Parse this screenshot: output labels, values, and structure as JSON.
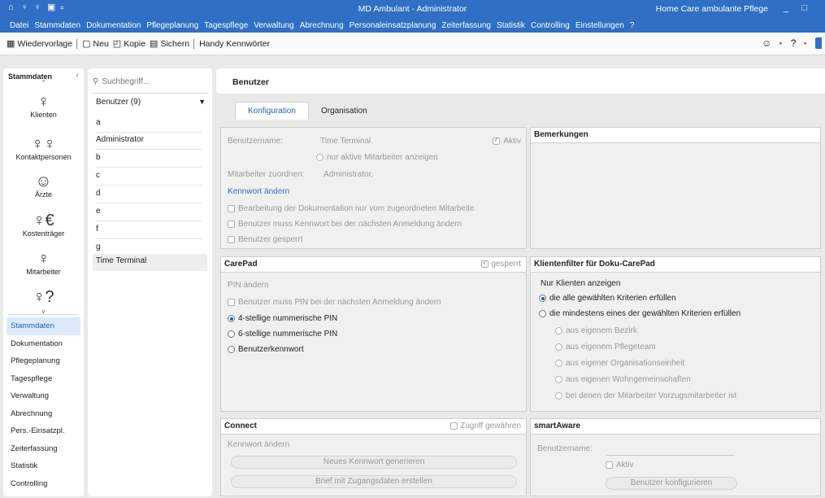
{
  "titlebar": {
    "title": "MD Ambulant - Administrator",
    "right_title": "Home Care ambulante Pflege",
    "minimize": "_",
    "maximize": "□"
  },
  "menu": [
    "Datei",
    "Stammdaten",
    "Dokumentation",
    "Pflegeplanung",
    "Tagespflege",
    "Verwaltung",
    "Abrechnung",
    "Personaleinsatzplanung",
    "Zeiterfassung",
    "Statistik",
    "Controlling",
    "Einstellungen",
    "?"
  ],
  "toolbar": {
    "wiedervorlage": "Wiedervorlage",
    "neu": "Neu",
    "kopie": "Kopie",
    "sichern": "Sichern",
    "handy": "Handy Kennwörter"
  },
  "leftnav": {
    "heading": "Stammdaten",
    "icons": [
      {
        "label": "Klienten",
        "icon": "person-icon"
      },
      {
        "label": "Kontaktpersonen",
        "icon": "persons-icon"
      },
      {
        "label": "Ärzte",
        "icon": "doctor-icon"
      },
      {
        "label": "Kostenträger",
        "icon": "payer-icon"
      },
      {
        "label": "Mitarbeiter",
        "icon": "employee-icon"
      }
    ],
    "modules": [
      "Stammdaten",
      "Dokumentation",
      "Pflegeplanung",
      "Tagespflege",
      "Verwaltung",
      "Abrechnung",
      "Pers.-Einsatzpl.",
      "Zeiterfassung",
      "Statistik",
      "Controlling"
    ]
  },
  "userlist": {
    "search_placeholder": "Suchbegriff...",
    "group": "Benutzer (9)",
    "items": [
      "a",
      "Administrator",
      "b",
      "c",
      "d",
      "e",
      "f",
      "g",
      "Time Terminal"
    ]
  },
  "main": {
    "header": "Benutzer",
    "tabs": [
      "Konfiguration",
      "Organisation"
    ],
    "config": {
      "username_label": "Benutzername:",
      "username_value": "Time Terminal",
      "aktiv": "Aktiv",
      "only_active": "nur aktive Mitarbeiter anzeigen",
      "assign_label": "Mitarbeiter zuordnen:",
      "assign_value": "Administrator,",
      "change_password": "Kennwort ändern",
      "opt1": "Bearbeitung der Dokumentation nur vom zugeordneten Mitarbeite",
      "opt2": "Benutzer muss Kennwort bei der nächsten Anmeldung ändern",
      "opt3": "Benutzer gesperrt"
    },
    "remarks": {
      "title": "Bemerkungen"
    },
    "carepad": {
      "title": "CarePad",
      "gesperrt": "gesperrt",
      "pin_change": "PIN ändern",
      "pin_must_change": "Benutzer muss PIN bei der nächsten Anmeldung ändern",
      "pin4": "4-stellige nummerische PIN",
      "pin6": "6-stellige nummerische PIN",
      "userpw": "Benutzerkennwort"
    },
    "filter": {
      "title": "Klientenfilter für Doku-CarePad",
      "subtitle": "Nur Klienten anzeigen",
      "all": "die alle gewählten Kriterien erfüllen",
      "any": "die mindestens eines der gewählten Kriterien erfüllen",
      "criteria": [
        "aus eigenem Bezirk",
        "aus eigenem Pflegeteam",
        "aus eigener Organisationseinheit",
        "aus eigenen Wohngemeinschaften",
        "bei denen der Mitarbeiter Vorzugsmitarbeiter ist"
      ]
    },
    "connect": {
      "title": "Connect",
      "access": "Zugriff gewähren",
      "pw_change": "Kennwort ändern",
      "gen_btn": "Neues Kennwort generieren",
      "letter_btn": "Brief mit Zugangsdaten erstellen"
    },
    "smartaware": {
      "title": "smartAware",
      "username_label": "Benutzername:",
      "aktiv": "Aktiv",
      "config_btn": "Benutzer konfigurieren"
    }
  }
}
